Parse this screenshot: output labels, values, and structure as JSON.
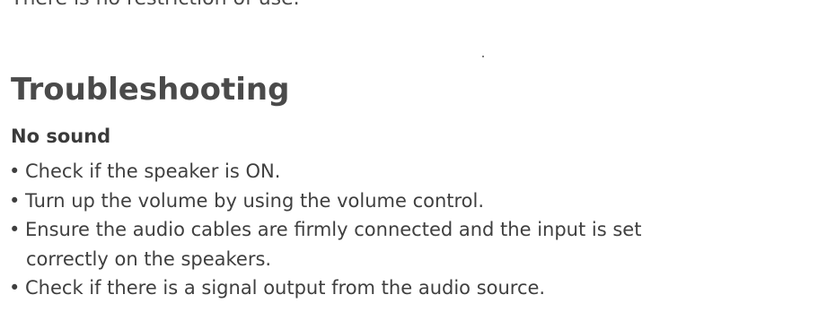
{
  "top_fragment": "There is no restriction of use.",
  "section_title": "Troubleshooting",
  "issue": {
    "title": "No sound",
    "bullet_glyph": "•",
    "steps": [
      {
        "line1": "Check if the speaker is ON.",
        "line2": ""
      },
      {
        "line1": "Turn up the volume by using the volume control.",
        "line2": ""
      },
      {
        "line1": "Ensure the audio cables are firmly connected and the input is set",
        "line2": "correctly on the speakers."
      },
      {
        "line1": "Check if there is a signal output from the audio source.",
        "line2": ""
      }
    ]
  }
}
